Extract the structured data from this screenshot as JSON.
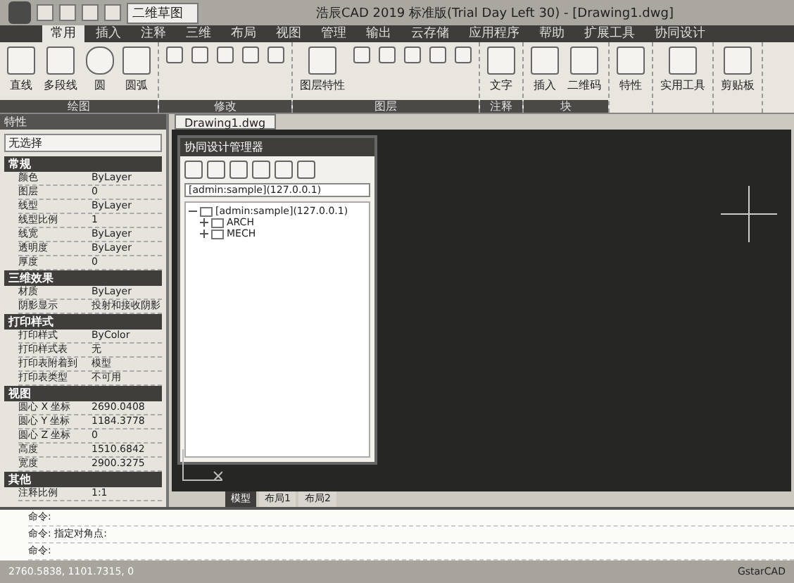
{
  "window": {
    "title": "浩辰CAD 2019 标准版(Trial Day Left 30) - [Drawing1.dwg]",
    "workspace": "二维草图"
  },
  "ribbon_tabs": [
    {
      "label": "常用",
      "selected": true
    },
    {
      "label": "插入",
      "selected": false
    },
    {
      "label": "注释",
      "selected": false
    },
    {
      "label": "三维",
      "selected": false
    },
    {
      "label": "布局",
      "selected": false
    },
    {
      "label": "视图",
      "selected": false
    },
    {
      "label": "管理",
      "selected": false
    },
    {
      "label": "输出",
      "selected": false
    },
    {
      "label": "云存储",
      "selected": false
    },
    {
      "label": "应用程序",
      "selected": false
    },
    {
      "label": "帮助",
      "selected": false
    },
    {
      "label": "扩展工具",
      "selected": false
    },
    {
      "label": "协同设计",
      "selected": false
    }
  ],
  "ribbon_panels": [
    {
      "title": "绘图",
      "buttons": [
        "直线",
        "多段线",
        "圆",
        "圆弧"
      ]
    },
    {
      "title": "修改"
    },
    {
      "title": "图层",
      "buttons": [
        "图层特性"
      ]
    },
    {
      "title": "注释",
      "buttons": [
        "文字"
      ]
    },
    {
      "title": "块",
      "buttons": [
        "插入",
        "二维码"
      ]
    },
    {
      "buttons": [
        "特性"
      ]
    },
    {
      "buttons": [
        "实用工具"
      ]
    },
    {
      "buttons": [
        "剪贴板"
      ]
    }
  ],
  "properties": {
    "title": "特性",
    "selection": "无选择",
    "sections": [
      {
        "title": "常规",
        "rows": [
          {
            "label": "颜色",
            "value": "ByLayer"
          },
          {
            "label": "图层",
            "value": "0"
          },
          {
            "label": "线型",
            "value": "ByLayer"
          },
          {
            "label": "线型比例",
            "value": "1"
          },
          {
            "label": "线宽",
            "value": "ByLayer"
          },
          {
            "label": "透明度",
            "value": "ByLayer"
          },
          {
            "label": "厚度",
            "value": "0"
          }
        ]
      },
      {
        "title": "三维效果",
        "rows": [
          {
            "label": "材质",
            "value": "ByLayer"
          },
          {
            "label": "阴影显示",
            "value": "投射和接收阴影"
          }
        ]
      },
      {
        "title": "打印样式",
        "rows": [
          {
            "label": "打印样式",
            "value": "ByColor"
          },
          {
            "label": "打印样式表",
            "value": "无"
          },
          {
            "label": "打印表附着到",
            "value": "模型"
          },
          {
            "label": "打印表类型",
            "value": "不可用"
          }
        ]
      },
      {
        "title": "视图",
        "rows": [
          {
            "label": "圆心 X 坐标",
            "value": "2690.0408"
          },
          {
            "label": "圆心 Y 坐标",
            "value": "1184.3778"
          },
          {
            "label": "圆心 Z 坐标",
            "value": "0"
          },
          {
            "label": "高度",
            "value": "1510.6842"
          },
          {
            "label": "宽度",
            "value": "2900.3275"
          }
        ]
      },
      {
        "title": "其他",
        "rows": [
          {
            "label": "注释比例",
            "value": "1:1"
          }
        ]
      }
    ]
  },
  "document_tabs": [
    {
      "label": "Drawing1.dwg",
      "selected": true
    }
  ],
  "collab_manager": {
    "title": "协同设计管理器",
    "server": "[admin:sample](127.0.0.1)",
    "tree": [
      {
        "label": "[admin:sample](127.0.0.1)",
        "expanded": true,
        "children": [
          {
            "label": "ARCH",
            "expanded": false
          },
          {
            "label": "MECH",
            "expanded": false
          }
        ]
      }
    ]
  },
  "layout_tabs": [
    {
      "label": "模型",
      "selected": true
    },
    {
      "label": "布局1",
      "selected": false
    },
    {
      "label": "布局2",
      "selected": false
    }
  ],
  "command_lines": [
    "命令:",
    "命令: 指定对角点:",
    "命令:"
  ],
  "status_bar": {
    "coordinates": "2760.5838, 1101.7315, 0",
    "brand": "GstarCAD"
  }
}
